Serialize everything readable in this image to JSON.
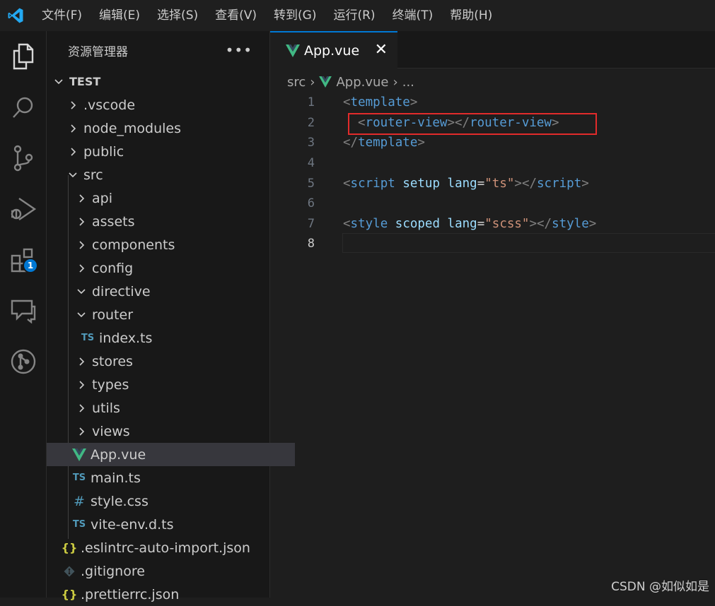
{
  "menubar": {
    "items": [
      "文件(F)",
      "编辑(E)",
      "选择(S)",
      "查看(V)",
      "转到(G)",
      "运行(R)",
      "终端(T)",
      "帮助(H)"
    ]
  },
  "activitybar": {
    "extensions_badge": "1"
  },
  "sidebar": {
    "title": "资源管理器",
    "root": "TEST",
    "items": [
      {
        "label": ".vscode"
      },
      {
        "label": "node_modules"
      },
      {
        "label": "public"
      },
      {
        "label": "src"
      },
      {
        "label": "api"
      },
      {
        "label": "assets"
      },
      {
        "label": "components"
      },
      {
        "label": "config"
      },
      {
        "label": "directive"
      },
      {
        "label": "router"
      },
      {
        "label": "index.ts"
      },
      {
        "label": "stores"
      },
      {
        "label": "types"
      },
      {
        "label": "utils"
      },
      {
        "label": "views"
      },
      {
        "label": "App.vue"
      },
      {
        "label": "main.ts"
      },
      {
        "label": "style.css"
      },
      {
        "label": "vite-env.d.ts"
      },
      {
        "label": ".eslintrc-auto-import.json"
      },
      {
        "label": ".gitignore"
      },
      {
        "label": ".prettierrc.json"
      }
    ],
    "icon_text": {
      "ts": "TS",
      "css": "#",
      "json": "{}"
    }
  },
  "editor": {
    "tab_label": "App.vue",
    "breadcrumb": {
      "folder": "src",
      "file": "App.vue",
      "more": "..."
    },
    "line_numbers": [
      "1",
      "2",
      "3",
      "4",
      "5",
      "6",
      "7",
      "8"
    ],
    "code": {
      "l1_tag": "template",
      "l2_tag_open": "router-view",
      "l2_tag_close": "router-view",
      "l3_tag": "template",
      "l5_tag": "script",
      "l5_attr1": "setup",
      "l5_attr2": "lang",
      "l5_val": "\"ts\"",
      "l5_close": "script",
      "l7_tag": "style",
      "l7_attr1": "scoped",
      "l7_attr2": "lang",
      "l7_val": "\"scss\"",
      "l7_close": "style"
    }
  },
  "watermark": "CSDN @如似如是",
  "colors": {
    "accent": "#0078d4",
    "vue_green": "#41b883",
    "highlight_red": "#e22b2b"
  }
}
